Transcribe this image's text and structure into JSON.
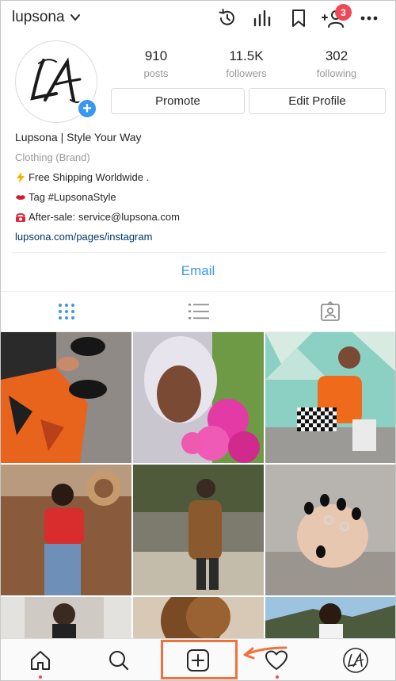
{
  "app": {
    "username": "lupsona",
    "notification_count": "3"
  },
  "top_icons": [
    "activity-history-icon",
    "insights-icon",
    "saved-bookmark-icon",
    "discover-people-icon",
    "more-options-icon"
  ],
  "profile": {
    "avatar_monogram": "LA",
    "stats": [
      {
        "value": "910",
        "label": "posts"
      },
      {
        "value": "11.5K",
        "label": "followers"
      },
      {
        "value": "302",
        "label": "following"
      }
    ],
    "promote_label": "Promote",
    "edit_profile_label": "Edit Profile"
  },
  "bio": {
    "name": "Lupsona | Style Your Way",
    "category": "Clothing (Brand)",
    "line1": "Free Shipping Worldwide .",
    "line2": "Tag #LupsonaStyle",
    "line3": "After-sale: service@lupsona.com",
    "link": "lupsona.com/pages/instagram"
  },
  "contact": {
    "email_label": "Email"
  },
  "tabs": [
    {
      "name": "grid-view-icon",
      "active": true
    },
    {
      "name": "list-view-icon",
      "active": false
    },
    {
      "name": "tagged-photos-icon",
      "active": false
    }
  ],
  "posts": [
    {
      "desc": "orange camo pants and black boots"
    },
    {
      "desc": "woman with white hair and pink flowers"
    },
    {
      "desc": "orange hoodie and checkered pants"
    },
    {
      "desc": "red t-shirt and jeans"
    },
    {
      "desc": "brown coat on sunny street"
    },
    {
      "desc": "black nails and silver rings"
    },
    {
      "desc": "mirror selfie"
    },
    {
      "desc": "curly hair portrait"
    },
    {
      "desc": "beach portrait"
    }
  ],
  "bottom_nav": [
    "home-icon",
    "search-icon",
    "new-post-icon",
    "activity-heart-icon",
    "profile-avatar-icon"
  ],
  "colors": {
    "accent_blue": "#3897f0",
    "badge_red": "#ed4956",
    "annotation_orange": "#f2703c",
    "link_navy": "#003569"
  }
}
